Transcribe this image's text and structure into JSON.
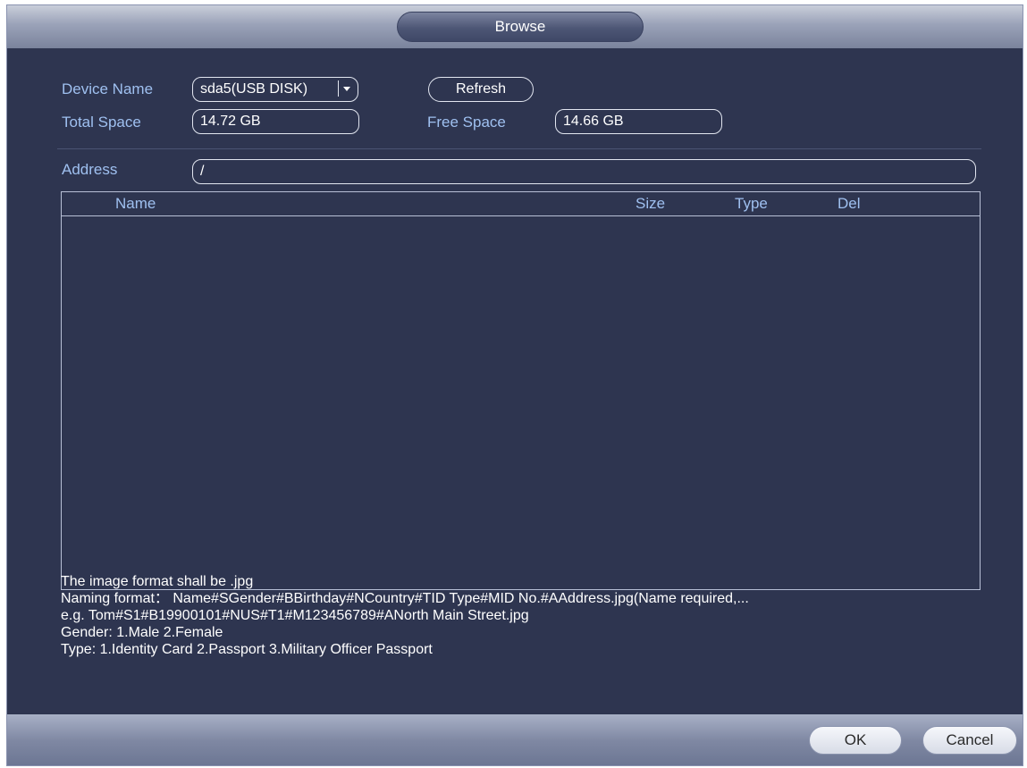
{
  "window": {
    "title": "Browse"
  },
  "device": {
    "name_label": "Device Name",
    "name_value": "sda5(USB DISK)",
    "refresh_label": "Refresh",
    "total_label": "Total Space",
    "total_value": "14.72 GB",
    "free_label": "Free Space",
    "free_value": "14.66 GB"
  },
  "address": {
    "label": "Address",
    "value": "/"
  },
  "table": {
    "columns": [
      "Name",
      "Size",
      "Type",
      "Del"
    ],
    "rows": []
  },
  "notes": [
    "The image format shall be  .jpg",
    " Naming format： Name#SGender#BBirthday#NCountry#TID Type#MID No.#AAddress.jpg(Name required,...",
    "e.g. Tom#S1#B19900101#NUS#T1#M123456789#ANorth Main Street.jpg",
    "Gender: 1.Male 2.Female",
    "Type: 1.Identity Card 2.Passport 3.Military Officer Passport"
  ],
  "footer": {
    "ok_label": "OK",
    "cancel_label": "Cancel"
  }
}
